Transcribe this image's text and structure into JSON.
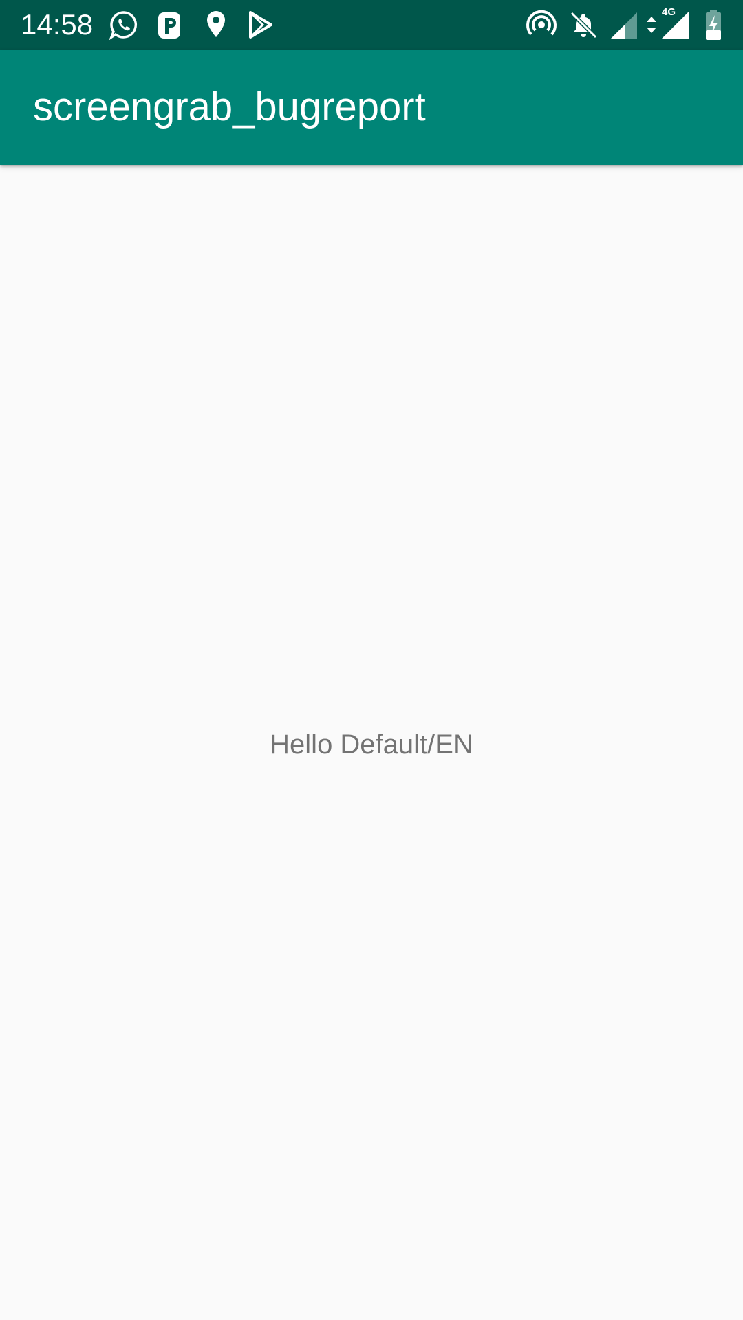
{
  "status_bar": {
    "time": "14:58",
    "network_label": "4G",
    "background_color": "#00574b",
    "notification_icons": [
      "whatsapp-icon",
      "parking-p-icon",
      "location-pin-icon",
      "play-store-icon"
    ],
    "system_icons": [
      "hotspot-icon",
      "notifications-off-icon",
      "signal-icon",
      "data-arrows-icon",
      "signal-4g-icon",
      "battery-charging-icon"
    ]
  },
  "app_bar": {
    "title": "screengrab_bugreport",
    "background_color": "#008577"
  },
  "content": {
    "message": "Hello Default/EN",
    "text_color": "#737373",
    "background_color": "#fafafa"
  }
}
